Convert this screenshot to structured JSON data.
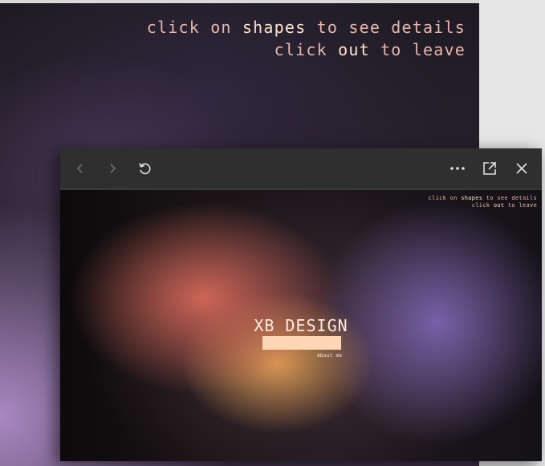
{
  "background_page": {
    "hint_line1_pre": "click on ",
    "hint_line1_highlight": "shapes",
    "hint_line1_post": " to see details",
    "hint_line2_pre": "click ",
    "hint_line2_highlight": "out",
    "hint_line2_post": " to leave"
  },
  "popup": {
    "toolbar": {
      "back_icon": "chevron-left-icon",
      "forward_icon": "chevron-right-icon",
      "refresh_icon": "refresh-icon",
      "more_icon": "more-horizontal-icon",
      "open_external_icon": "open-external-icon",
      "close_icon": "close-icon"
    },
    "content": {
      "hint_line1_pre": "click on ",
      "hint_line1_highlight": "shapes",
      "hint_line1_post": " to see details",
      "hint_line2_pre": "click ",
      "hint_line2_highlight": "out",
      "hint_line2_post": " to leave",
      "title": "XB DESIGN",
      "about_link": "About me"
    }
  },
  "colors": {
    "hint_text": "#e8b6ae",
    "hint_highlight": "#ffe4c9",
    "title_bar": "#fdd6b5",
    "toolbar": "#2f2f2f"
  }
}
